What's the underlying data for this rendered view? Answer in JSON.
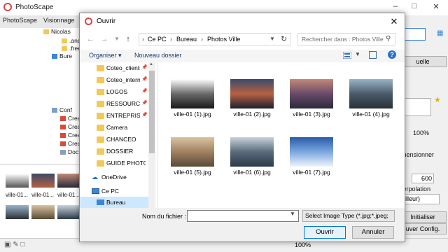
{
  "app": {
    "title": "PhotoScape",
    "tabs": [
      "PhotoScape",
      "Visionnage"
    ],
    "tree_items": [
      ".and",
      ".free",
      "Bure",
      "Conf",
      "Crea",
      "Crea",
      "Crea",
      "Crea",
      "Doc"
    ],
    "tree_user": "Nicolas",
    "bottom_thumbs": [
      "ville-01...",
      "ville-01...",
      "ville-01..."
    ],
    "bottom_zoom": "100%",
    "right_panel": {
      "btn_actuelle": "uelle",
      "percent": "100%",
      "dimension_label": "mensionner",
      "size_value": "600",
      "interp_label": "terpolation",
      "interp_value": "eilleur)",
      "reset_button": "Initialiser",
      "config_button": "uver Config."
    }
  },
  "dialog": {
    "title": "Ouvrir",
    "breadcrumb": [
      "Ce PC",
      "Bureau",
      "Photos Ville"
    ],
    "search_placeholder": "Rechercher dans : Photos Ville",
    "organise": "Organiser",
    "new_folder": "Nouveau dossier",
    "nav_items": [
      {
        "label": "Coteo_clients",
        "pinned": true
      },
      {
        "label": "Coteo_internes",
        "pinned": true
      },
      {
        "label": "LOGOS",
        "pinned": true
      },
      {
        "label": "RESSOURCES",
        "pinned": true
      },
      {
        "label": "ENTREPRISES",
        "pinned": true
      },
      {
        "label": "Camera",
        "pinned": false
      },
      {
        "label": "CHANCEO",
        "pinned": false
      },
      {
        "label": "DOSSIER",
        "pinned": false
      },
      {
        "label": "GUIDE PHOTOS",
        "pinned": false
      }
    ],
    "onedrive": "OneDrive",
    "this_pc": "Ce PC",
    "bureau": "Bureau",
    "files": [
      {
        "name": "ville-01 (1).jpg",
        "colors": [
          "#ffffff",
          "#6a6a6a",
          "#1a1a1a"
        ]
      },
      {
        "name": "ville-01 (2).jpg",
        "colors": [
          "#3a4a6a",
          "#b86040",
          "#1a2030"
        ]
      },
      {
        "name": "ville-01 (3).jpg",
        "colors": [
          "#c08a78",
          "#6a4a6a",
          "#2a2a3a"
        ]
      },
      {
        "name": "ville-01 (4).jpg",
        "colors": [
          "#9ab4c8",
          "#4a5a6a",
          "#2a3038"
        ]
      },
      {
        "name": "ville-01 (5).jpg",
        "colors": [
          "#d8c4a0",
          "#a08060",
          "#5a4a38"
        ]
      },
      {
        "name": "ville-01 (6).jpg",
        "colors": [
          "#c8d4dc",
          "#5a6a7a",
          "#2a3a48"
        ]
      },
      {
        "name": "ville-01 (7).jpg",
        "colors": [
          "#2a5aa8",
          "#7aa8e0",
          "#f0f4f8"
        ]
      }
    ],
    "filename_label": "Nom du fichier :",
    "filename_value": "",
    "filetype_value": "Select Image Type  (*.jpg;*.jpeg;",
    "open_button": "Ouvrir",
    "cancel_button": "Annuler"
  }
}
